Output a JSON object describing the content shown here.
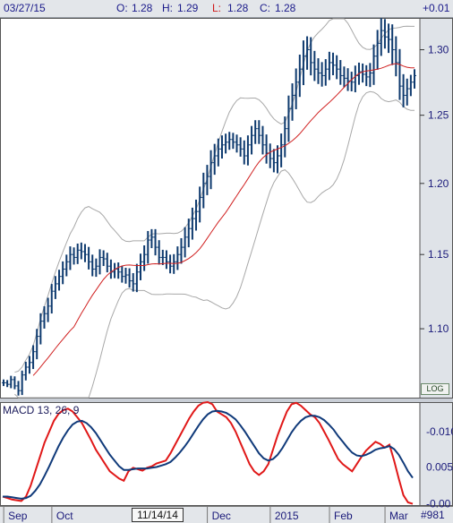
{
  "header": {
    "date": "03/27/15",
    "open_label": "O:",
    "open": "1.28",
    "high_label": "H:",
    "high": "1.29",
    "low_label": "L:",
    "low": "1.28",
    "close_label": "C:",
    "close": "1.28",
    "change": "+0.01"
  },
  "colors": {
    "bars": "#0e3a6e",
    "ma_line": "#d02020",
    "bands": "#a8a8a8",
    "macd_line": "#e01818",
    "signal_line": "#103a7a",
    "header_bg": "#e3e6ea",
    "axis_bg": "#dfe3e8"
  },
  "log_label": "LOG",
  "cursor_date": "11/14/14",
  "row_id": "#981",
  "x_axis": {
    "labels": [
      {
        "text": "Sep",
        "idx": 1
      },
      {
        "text": "Oct",
        "idx": 14
      },
      {
        "text": "Dec",
        "idx": 56
      },
      {
        "text": "2015",
        "idx": 73
      },
      {
        "text": "Feb",
        "idx": 89
      },
      {
        "text": "Mar",
        "idx": 104
      }
    ]
  },
  "chart_data": [
    {
      "type": "bar",
      "title": "",
      "description_kind": "OHLC price bars with moving average and Bollinger bands",
      "y_ticks": [
        "1.30",
        "1.25",
        "1.20",
        "1.15",
        "1.10"
      ],
      "ylim": [
        1.055,
        1.325
      ],
      "log_scale": true,
      "grid": false,
      "close": [
        1.065,
        1.064,
        1.067,
        1.063,
        1.06,
        1.07,
        1.075,
        1.078,
        1.085,
        1.095,
        1.105,
        1.11,
        1.115,
        1.125,
        1.13,
        1.135,
        1.14,
        1.145,
        1.15,
        1.148,
        1.153,
        1.152,
        1.15,
        1.145,
        1.14,
        1.142,
        1.148,
        1.147,
        1.142,
        1.138,
        1.14,
        1.138,
        1.135,
        1.136,
        1.132,
        1.13,
        1.138,
        1.145,
        1.15,
        1.16,
        1.162,
        1.155,
        1.148,
        1.148,
        1.145,
        1.142,
        1.145,
        1.15,
        1.155,
        1.162,
        1.168,
        1.175,
        1.18,
        1.19,
        1.2,
        1.205,
        1.215,
        1.22,
        1.225,
        1.228,
        1.23,
        1.232,
        1.23,
        1.228,
        1.225,
        1.22,
        1.228,
        1.235,
        1.24,
        1.235,
        1.228,
        1.222,
        1.218,
        1.215,
        1.22,
        1.228,
        1.24,
        1.255,
        1.265,
        1.275,
        1.285,
        1.295,
        1.3,
        1.29,
        1.285,
        1.282,
        1.28,
        1.285,
        1.29,
        1.288,
        1.285,
        1.28,
        1.278,
        1.276,
        1.275,
        1.28,
        1.283,
        1.281,
        1.279,
        1.282,
        1.295,
        1.305,
        1.315,
        1.31,
        1.308,
        1.3,
        1.29,
        1.272,
        1.265,
        1.27,
        1.275,
        1.28
      ],
      "bar_range": [
        0.006,
        0.005,
        0.007,
        0.006,
        0.009,
        0.008,
        0.01,
        0.012,
        0.012,
        0.014,
        0.015,
        0.014,
        0.016,
        0.014,
        0.015,
        0.013,
        0.015,
        0.014,
        0.016,
        0.014,
        0.013,
        0.015,
        0.015,
        0.015,
        0.014,
        0.015,
        0.016,
        0.014,
        0.012,
        0.013,
        0.012,
        0.013,
        0.012,
        0.014,
        0.013,
        0.015,
        0.016,
        0.016,
        0.018,
        0.018,
        0.016,
        0.016,
        0.014,
        0.015,
        0.014,
        0.014,
        0.015,
        0.016,
        0.018,
        0.02,
        0.02,
        0.022,
        0.024,
        0.022,
        0.022,
        0.024,
        0.026,
        0.025,
        0.022,
        0.02,
        0.018,
        0.016,
        0.014,
        0.016,
        0.016,
        0.018,
        0.02,
        0.02,
        0.018,
        0.018,
        0.02,
        0.022,
        0.02,
        0.02,
        0.022,
        0.024,
        0.026,
        0.028,
        0.026,
        0.03,
        0.032,
        0.035,
        0.03,
        0.028,
        0.026,
        0.024,
        0.024,
        0.022,
        0.024,
        0.022,
        0.022,
        0.02,
        0.02,
        0.022,
        0.02,
        0.022,
        0.02,
        0.018,
        0.02,
        0.022,
        0.026,
        0.03,
        0.028,
        0.026,
        0.03,
        0.034,
        0.03,
        0.03,
        0.026,
        0.022,
        0.016,
        0.014
      ]
    },
    {
      "type": "line",
      "title": "MACD 13, 26, 9",
      "y_ticks": [
        "0.010",
        "0.0051",
        "0.00"
      ],
      "y_values": [
        0.01,
        0.0051,
        0.0
      ],
      "ylim": [
        -0.0003,
        0.0141
      ],
      "grid": false,
      "series": [
        {
          "name": "MACD",
          "values": [
            0.001,
            0.0008,
            0.0006,
            0.0005,
            0.0004,
            0.001,
            0.0025,
            0.0045,
            0.0065,
            0.0085,
            0.01,
            0.0115,
            0.0125,
            0.013,
            0.0132,
            0.0128,
            0.012,
            0.0112,
            0.01,
            0.0088,
            0.0075,
            0.0065,
            0.0055,
            0.0045,
            0.004,
            0.0035,
            0.0032,
            0.0045,
            0.005,
            0.0048,
            0.0046,
            0.005,
            0.0052,
            0.0056,
            0.0058,
            0.006,
            0.007,
            0.0082,
            0.0094,
            0.0106,
            0.0118,
            0.0128,
            0.0136,
            0.014,
            0.0141,
            0.0138,
            0.0128,
            0.0124,
            0.012,
            0.0112,
            0.01,
            0.0085,
            0.007,
            0.0055,
            0.0045,
            0.004,
            0.0045,
            0.0055,
            0.0075,
            0.0095,
            0.0112,
            0.0128,
            0.0138,
            0.014,
            0.0136,
            0.013,
            0.0124,
            0.012,
            0.0112,
            0.01,
            0.0088,
            0.0075,
            0.0062,
            0.0055,
            0.005,
            0.0045,
            0.0055,
            0.0065,
            0.0074,
            0.008,
            0.0086,
            0.0083,
            0.0078,
            0.0082,
            0.006,
            0.0035,
            0.0012,
            0.0002,
            0.0
          ]
        },
        {
          "name": "Signal",
          "values": [
            0.001,
            0.001,
            0.0009,
            0.0008,
            0.0007,
            0.0008,
            0.0011,
            0.0018,
            0.0027,
            0.0039,
            0.0052,
            0.0066,
            0.008,
            0.0092,
            0.0102,
            0.011,
            0.0114,
            0.0115,
            0.0112,
            0.0106,
            0.0098,
            0.0088,
            0.0078,
            0.0068,
            0.006,
            0.0052,
            0.0047,
            0.0047,
            0.0048,
            0.0049,
            0.0049,
            0.0049,
            0.005,
            0.0051,
            0.0053,
            0.0055,
            0.0058,
            0.0064,
            0.0071,
            0.0079,
            0.0088,
            0.0098,
            0.0108,
            0.0117,
            0.0124,
            0.0128,
            0.0129,
            0.0128,
            0.0126,
            0.0122,
            0.0117,
            0.0109,
            0.01,
            0.009,
            0.008,
            0.007,
            0.0063,
            0.006,
            0.0062,
            0.0068,
            0.0077,
            0.0088,
            0.0099,
            0.0108,
            0.0115,
            0.012,
            0.0122,
            0.0122,
            0.012,
            0.0116,
            0.011,
            0.0103,
            0.0094,
            0.0086,
            0.0078,
            0.0071,
            0.0067,
            0.0066,
            0.0068,
            0.0071,
            0.0075,
            0.0077,
            0.0078,
            0.008,
            0.0076,
            0.0068,
            0.0057,
            0.0045,
            0.0036
          ]
        }
      ]
    }
  ]
}
